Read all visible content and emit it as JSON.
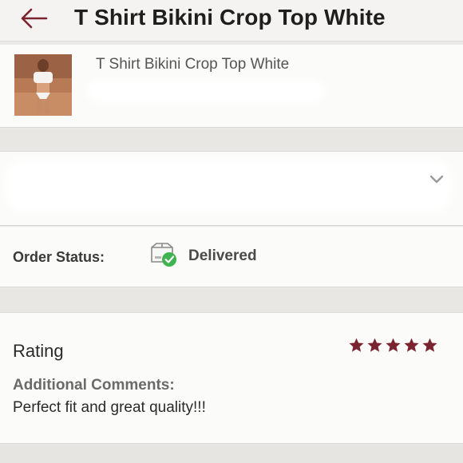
{
  "header": {
    "title": "T Shirt Bikini Crop Top White",
    "back_icon": "arrow-left-icon",
    "accent_color": "#7a2430"
  },
  "product": {
    "name": "T Shirt Bikini Crop Top White"
  },
  "order_status": {
    "label": "Order Status:",
    "value": "Delivered",
    "icon": "package-check-icon",
    "check_color": "#3fb34f"
  },
  "rating": {
    "label": "Rating",
    "stars": 5,
    "max_stars": 5,
    "star_color": "#7a2430",
    "comments_label": "Additional Comments:",
    "comments": "Perfect fit and great quality!!!"
  }
}
